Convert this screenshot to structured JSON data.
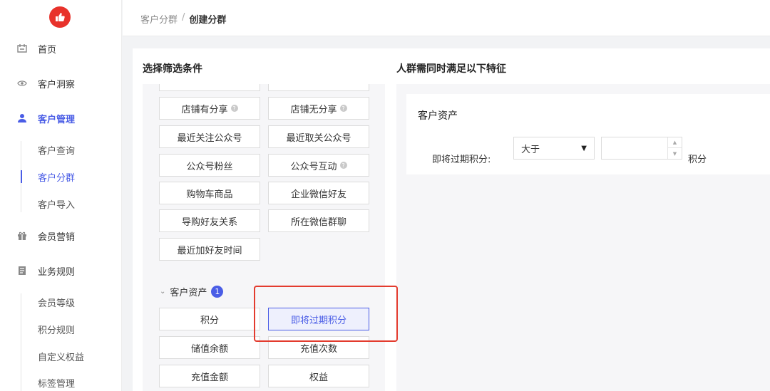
{
  "sidebar": {
    "nav": [
      {
        "label": "首页",
        "icon": "home-icon"
      },
      {
        "label": "客户洞察",
        "icon": "eye-icon"
      },
      {
        "label": "客户管理",
        "icon": "user-icon"
      },
      {
        "label": "会员营销",
        "icon": "gift-icon"
      },
      {
        "label": "业务规则",
        "icon": "document-icon"
      }
    ],
    "customer_sub": [
      "客户查询",
      "客户分群",
      "客户导入"
    ],
    "rules_sub": [
      "会员等级",
      "积分规则",
      "自定义权益",
      "标签管理"
    ]
  },
  "breadcrumb": {
    "parent": "客户分群",
    "separator": "/",
    "current": "创建分群"
  },
  "left_title": "选择筛选条件",
  "right_title": "人群需同时满足以下特征",
  "filters": [
    {
      "label": "店铺有分享"
    },
    {
      "label": "店铺无分享"
    },
    {
      "label": "最近关注公众号"
    },
    {
      "label": "最近取关公众号"
    },
    {
      "label": "公众号粉丝"
    },
    {
      "label": "公众号互动"
    },
    {
      "label": "购物车商品"
    },
    {
      "label": "企业微信好友"
    },
    {
      "label": "导购好友关系"
    },
    {
      "label": "所在微信群聊"
    },
    {
      "label": "最近加好友时间"
    }
  ],
  "asset_group": {
    "label": "客户资产",
    "count": "1",
    "items": [
      {
        "label": "积分"
      },
      {
        "label": "即将过期积分"
      },
      {
        "label": "储值余额"
      },
      {
        "label": "充值次数"
      },
      {
        "label": "充值金额"
      },
      {
        "label": "权益"
      }
    ]
  },
  "condition": {
    "title": "客户资产",
    "field_label": "即将过期积分:",
    "operator": "大于",
    "value": "",
    "unit": "积分"
  },
  "colors": {
    "accent": "#4a5de6",
    "highlight": "#e33b2e",
    "logo": "#e8322b"
  }
}
